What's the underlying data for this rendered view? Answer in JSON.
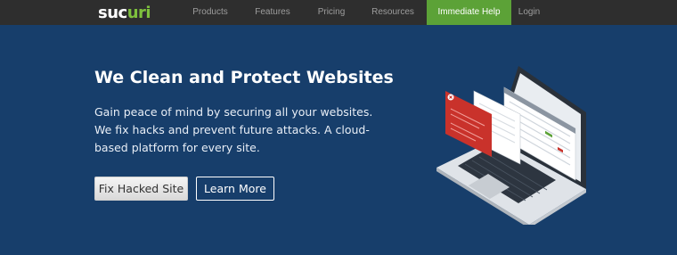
{
  "brand": {
    "logo_main": "suc",
    "logo_accent": "uri"
  },
  "nav": {
    "items": [
      {
        "label": "Products"
      },
      {
        "label": "Features"
      },
      {
        "label": "Pricing"
      },
      {
        "label": "Resources"
      },
      {
        "label": "Immediate Help"
      },
      {
        "label": "Login"
      }
    ]
  },
  "hero": {
    "title": "We Clean and Protect Websites",
    "description_lines": [
      "Gain peace of mind by securing all your websites.",
      "We fix hacks and prevent future attacks. A cloud-",
      "based platform for every site."
    ],
    "primary_button": "Fix Hacked Site",
    "secondary_button": "Learn More"
  },
  "colors": {
    "hero_bg": "#173e6b",
    "nav_bg": "#2e2e2e",
    "help_green": "#5ca237",
    "alert_red": "#c9322b"
  },
  "illustration": {
    "icon": "laptop-dashboard-illustration"
  }
}
